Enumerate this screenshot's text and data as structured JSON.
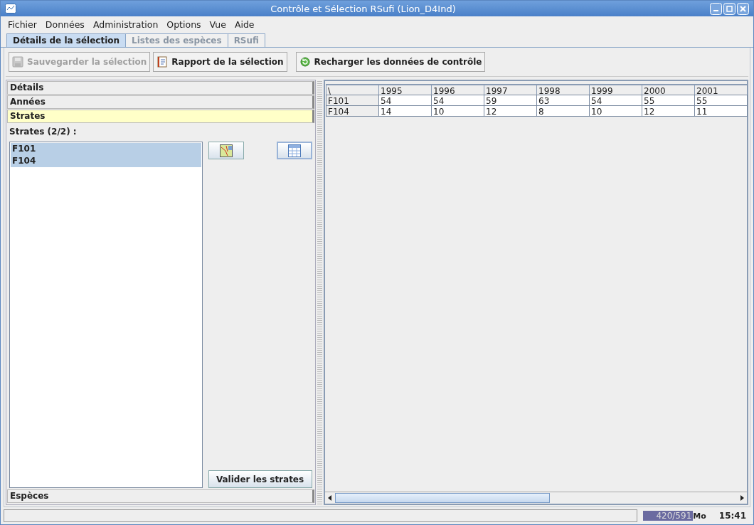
{
  "window": {
    "title": "Contrôle et Sélection RSufi (Lion_D4Ind)"
  },
  "menu": [
    "Fichier",
    "Données",
    "Administration",
    "Options",
    "Vue",
    "Aide"
  ],
  "tabs": [
    {
      "label": "Détails de la sélection",
      "selected": true
    },
    {
      "label": "Listes des espèces",
      "selected": false
    },
    {
      "label": "RSufi",
      "selected": false
    }
  ],
  "toolbar": [
    {
      "label": "Sauvegarder la sélection",
      "kind": "save",
      "disabled": true
    },
    {
      "label": "Rapport de la sélection",
      "kind": "report",
      "disabled": false
    },
    {
      "label": "Recharger les données de contrôle",
      "kind": "reload",
      "disabled": false
    }
  ],
  "sections_top": [
    {
      "label": "Détails",
      "selected": false
    },
    {
      "label": "Années",
      "selected": false
    },
    {
      "label": "Strates",
      "selected": true
    }
  ],
  "strates": {
    "label": "Strates (2/2) :",
    "items": [
      {
        "label": "F101",
        "selected": true
      },
      {
        "label": "F104",
        "selected": true
      }
    ],
    "validate_button": "Valider les strates"
  },
  "sections_bottom": [
    {
      "label": "Espèces",
      "selected": false
    }
  ],
  "table": {
    "corner": "\\",
    "columns": [
      "1995",
      "1996",
      "1997",
      "1998",
      "1999",
      "2000",
      "2001"
    ],
    "rows": [
      {
        "header": "F101",
        "cells": [
          "54",
          "54",
          "59",
          "63",
          "54",
          "55",
          "55"
        ]
      },
      {
        "header": "F104",
        "cells": [
          "14",
          "10",
          "12",
          "8",
          "10",
          "12",
          "11"
        ]
      }
    ]
  },
  "status_bar": {
    "memory": "420/591",
    "unit": "Mo",
    "time": "15:41"
  }
}
